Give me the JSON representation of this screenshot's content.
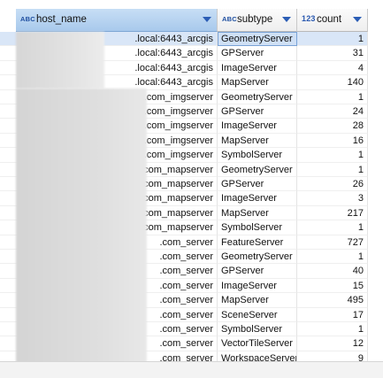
{
  "columns": [
    {
      "type_icon": "ABC",
      "label": "host_name"
    },
    {
      "type_icon": "ABC",
      "label": "subtype"
    },
    {
      "type_icon": "123",
      "label": "count"
    }
  ],
  "rows": [
    {
      "host": ".local:6443_arcgis",
      "subtype": "GeometryServer",
      "count": "1"
    },
    {
      "host": ".local:6443_arcgis",
      "subtype": "GPServer",
      "count": "31"
    },
    {
      "host": ".local:6443_arcgis",
      "subtype": "ImageServer",
      "count": "4"
    },
    {
      "host": ".local:6443_arcgis",
      "subtype": "MapServer",
      "count": "140"
    },
    {
      "host": ".com_imgserver",
      "subtype": "GeometryServer",
      "count": "1"
    },
    {
      "host": ".com_imgserver",
      "subtype": "GPServer",
      "count": "24"
    },
    {
      "host": ".com_imgserver",
      "subtype": "ImageServer",
      "count": "28"
    },
    {
      "host": ".com_imgserver",
      "subtype": "MapServer",
      "count": "16"
    },
    {
      "host": ".com_imgserver",
      "subtype": "SymbolServer",
      "count": "1"
    },
    {
      "host": ".com_mapserver",
      "subtype": "GeometryServer",
      "count": "1"
    },
    {
      "host": ".com_mapserver",
      "subtype": "GPServer",
      "count": "26"
    },
    {
      "host": ".com_mapserver",
      "subtype": "ImageServer",
      "count": "3"
    },
    {
      "host": ".com_mapserver",
      "subtype": "MapServer",
      "count": "217"
    },
    {
      "host": ".com_mapserver",
      "subtype": "SymbolServer",
      "count": "1"
    },
    {
      "host": ".com_server",
      "subtype": "FeatureServer",
      "count": "727"
    },
    {
      "host": ".com_server",
      "subtype": "GeometryServer",
      "count": "1"
    },
    {
      "host": ".com_server",
      "subtype": "GPServer",
      "count": "40"
    },
    {
      "host": ".com_server",
      "subtype": "ImageServer",
      "count": "15"
    },
    {
      "host": ".com_server",
      "subtype": "MapServer",
      "count": "495"
    },
    {
      "host": ".com_server",
      "subtype": "SceneServer",
      "count": "17"
    },
    {
      "host": ".com_server",
      "subtype": "SymbolServer",
      "count": "1"
    },
    {
      "host": ".com_server",
      "subtype": "VectorTileServer",
      "count": "12"
    },
    {
      "host": ".com_server",
      "subtype": "WorkspaceServer",
      "count": "9"
    }
  ]
}
